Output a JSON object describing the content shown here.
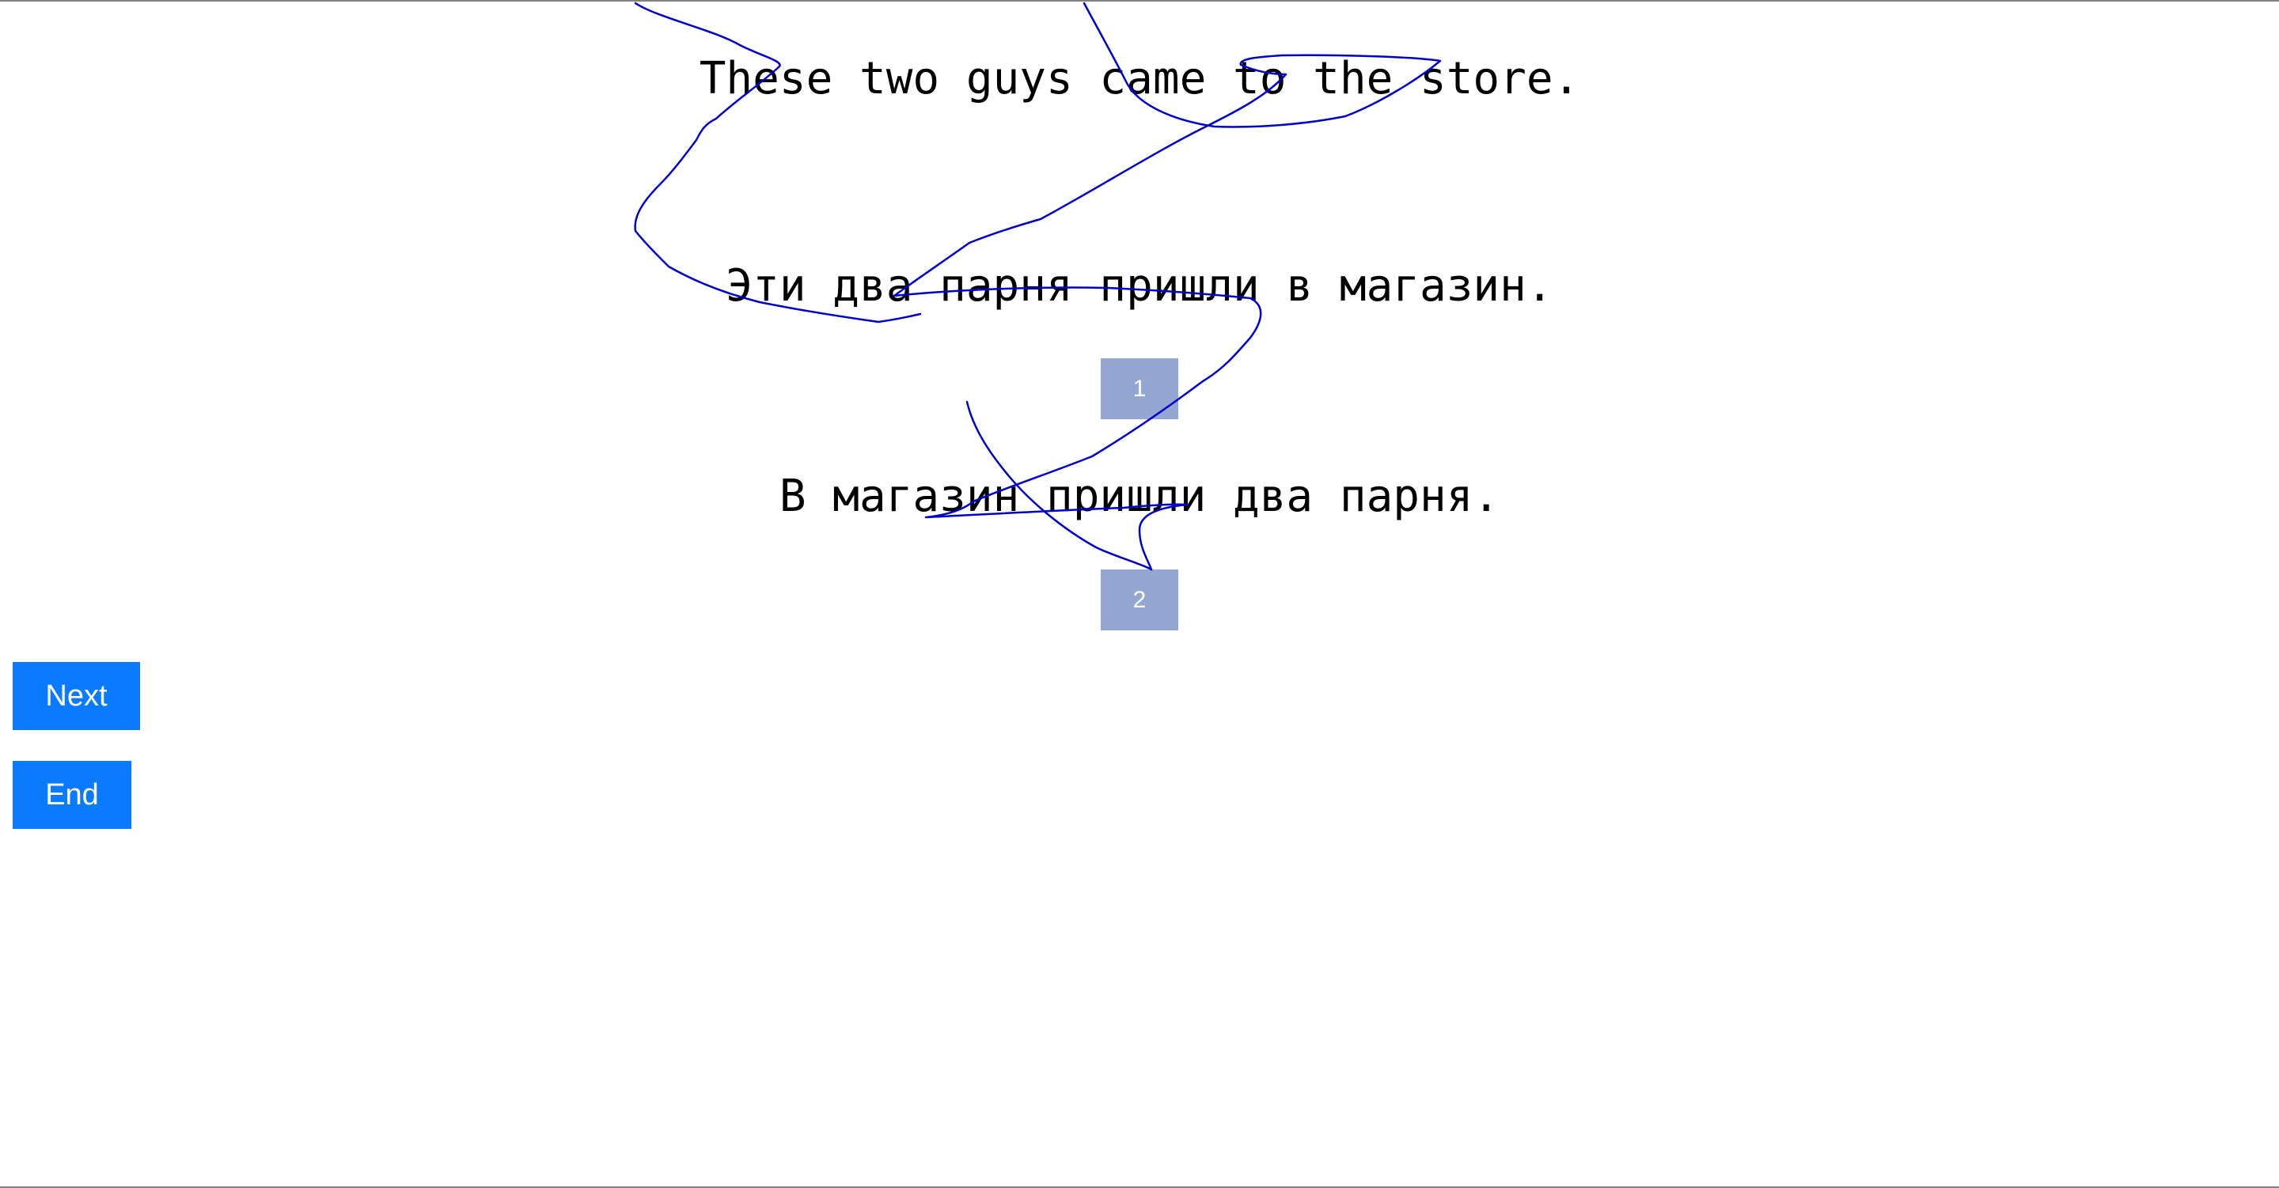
{
  "sentences": {
    "source": "These two guys came to the store.",
    "option_1": "Эти два парня пришли в магазин.",
    "option_2": "В магазин пришли два парня."
  },
  "choices": {
    "choice_1_label": "1",
    "choice_2_label": "2"
  },
  "actions": {
    "next_label": "Next",
    "end_label": "End"
  },
  "colors": {
    "choice_button": "#93a7d2",
    "action_button": "#0a7bff",
    "scribble_stroke": "#0000cc"
  }
}
